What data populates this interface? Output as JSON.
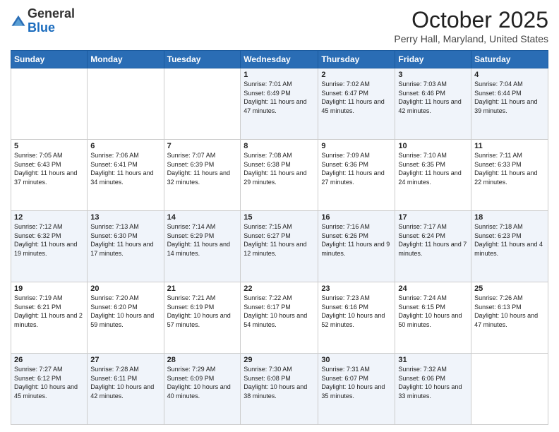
{
  "logo": {
    "general": "General",
    "blue": "Blue"
  },
  "title": "October 2025",
  "location": "Perry Hall, Maryland, United States",
  "days_header": [
    "Sunday",
    "Monday",
    "Tuesday",
    "Wednesday",
    "Thursday",
    "Friday",
    "Saturday"
  ],
  "weeks": [
    [
      {
        "day": "",
        "info": ""
      },
      {
        "day": "",
        "info": ""
      },
      {
        "day": "",
        "info": ""
      },
      {
        "day": "1",
        "info": "Sunrise: 7:01 AM\nSunset: 6:49 PM\nDaylight: 11 hours and 47 minutes."
      },
      {
        "day": "2",
        "info": "Sunrise: 7:02 AM\nSunset: 6:47 PM\nDaylight: 11 hours and 45 minutes."
      },
      {
        "day": "3",
        "info": "Sunrise: 7:03 AM\nSunset: 6:46 PM\nDaylight: 11 hours and 42 minutes."
      },
      {
        "day": "4",
        "info": "Sunrise: 7:04 AM\nSunset: 6:44 PM\nDaylight: 11 hours and 39 minutes."
      }
    ],
    [
      {
        "day": "5",
        "info": "Sunrise: 7:05 AM\nSunset: 6:43 PM\nDaylight: 11 hours and 37 minutes."
      },
      {
        "day": "6",
        "info": "Sunrise: 7:06 AM\nSunset: 6:41 PM\nDaylight: 11 hours and 34 minutes."
      },
      {
        "day": "7",
        "info": "Sunrise: 7:07 AM\nSunset: 6:39 PM\nDaylight: 11 hours and 32 minutes."
      },
      {
        "day": "8",
        "info": "Sunrise: 7:08 AM\nSunset: 6:38 PM\nDaylight: 11 hours and 29 minutes."
      },
      {
        "day": "9",
        "info": "Sunrise: 7:09 AM\nSunset: 6:36 PM\nDaylight: 11 hours and 27 minutes."
      },
      {
        "day": "10",
        "info": "Sunrise: 7:10 AM\nSunset: 6:35 PM\nDaylight: 11 hours and 24 minutes."
      },
      {
        "day": "11",
        "info": "Sunrise: 7:11 AM\nSunset: 6:33 PM\nDaylight: 11 hours and 22 minutes."
      }
    ],
    [
      {
        "day": "12",
        "info": "Sunrise: 7:12 AM\nSunset: 6:32 PM\nDaylight: 11 hours and 19 minutes."
      },
      {
        "day": "13",
        "info": "Sunrise: 7:13 AM\nSunset: 6:30 PM\nDaylight: 11 hours and 17 minutes."
      },
      {
        "day": "14",
        "info": "Sunrise: 7:14 AM\nSunset: 6:29 PM\nDaylight: 11 hours and 14 minutes."
      },
      {
        "day": "15",
        "info": "Sunrise: 7:15 AM\nSunset: 6:27 PM\nDaylight: 11 hours and 12 minutes."
      },
      {
        "day": "16",
        "info": "Sunrise: 7:16 AM\nSunset: 6:26 PM\nDaylight: 11 hours and 9 minutes."
      },
      {
        "day": "17",
        "info": "Sunrise: 7:17 AM\nSunset: 6:24 PM\nDaylight: 11 hours and 7 minutes."
      },
      {
        "day": "18",
        "info": "Sunrise: 7:18 AM\nSunset: 6:23 PM\nDaylight: 11 hours and 4 minutes."
      }
    ],
    [
      {
        "day": "19",
        "info": "Sunrise: 7:19 AM\nSunset: 6:21 PM\nDaylight: 11 hours and 2 minutes."
      },
      {
        "day": "20",
        "info": "Sunrise: 7:20 AM\nSunset: 6:20 PM\nDaylight: 10 hours and 59 minutes."
      },
      {
        "day": "21",
        "info": "Sunrise: 7:21 AM\nSunset: 6:19 PM\nDaylight: 10 hours and 57 minutes."
      },
      {
        "day": "22",
        "info": "Sunrise: 7:22 AM\nSunset: 6:17 PM\nDaylight: 10 hours and 54 minutes."
      },
      {
        "day": "23",
        "info": "Sunrise: 7:23 AM\nSunset: 6:16 PM\nDaylight: 10 hours and 52 minutes."
      },
      {
        "day": "24",
        "info": "Sunrise: 7:24 AM\nSunset: 6:15 PM\nDaylight: 10 hours and 50 minutes."
      },
      {
        "day": "25",
        "info": "Sunrise: 7:26 AM\nSunset: 6:13 PM\nDaylight: 10 hours and 47 minutes."
      }
    ],
    [
      {
        "day": "26",
        "info": "Sunrise: 7:27 AM\nSunset: 6:12 PM\nDaylight: 10 hours and 45 minutes."
      },
      {
        "day": "27",
        "info": "Sunrise: 7:28 AM\nSunset: 6:11 PM\nDaylight: 10 hours and 42 minutes."
      },
      {
        "day": "28",
        "info": "Sunrise: 7:29 AM\nSunset: 6:09 PM\nDaylight: 10 hours and 40 minutes."
      },
      {
        "day": "29",
        "info": "Sunrise: 7:30 AM\nSunset: 6:08 PM\nDaylight: 10 hours and 38 minutes."
      },
      {
        "day": "30",
        "info": "Sunrise: 7:31 AM\nSunset: 6:07 PM\nDaylight: 10 hours and 35 minutes."
      },
      {
        "day": "31",
        "info": "Sunrise: 7:32 AM\nSunset: 6:06 PM\nDaylight: 10 hours and 33 minutes."
      },
      {
        "day": "",
        "info": ""
      }
    ]
  ]
}
